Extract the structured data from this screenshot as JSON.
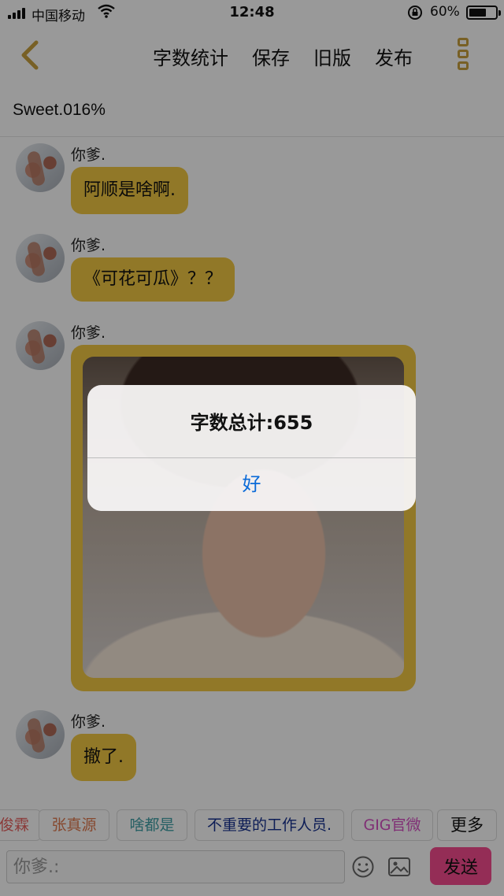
{
  "status_bar": {
    "carrier": "中国移动",
    "time": "12:48",
    "battery_percent": "60%",
    "battery_level": 0.6,
    "icons": [
      "signal-icon",
      "wifi-icon",
      "orientation-lock-icon",
      "battery-icon"
    ]
  },
  "nav": {
    "items": [
      "字数统计",
      "保存",
      "旧版",
      "发布"
    ],
    "accent_color": "#c9a13e"
  },
  "subtitle": "Sweet.016%",
  "messages": [
    {
      "sender": "你爹.",
      "text": "阿顺是啥啊."
    },
    {
      "sender": "你爹.",
      "text": "《可花可瓜》？？"
    },
    {
      "sender": "你爹.",
      "type": "image"
    },
    {
      "sender": "你爹.",
      "text": "撤了."
    }
  ],
  "chips": [
    "俊霖",
    "张真源",
    "啥都是",
    "不重要的工作人员.",
    "GIG官微",
    "更多"
  ],
  "input": {
    "placeholder": "你爹.:",
    "value": "",
    "send_label": "发送",
    "send_color": "#f74b8f"
  },
  "alert": {
    "title": "字数总计:655",
    "ok_label": "好"
  },
  "bubble_color": "#f2c843"
}
